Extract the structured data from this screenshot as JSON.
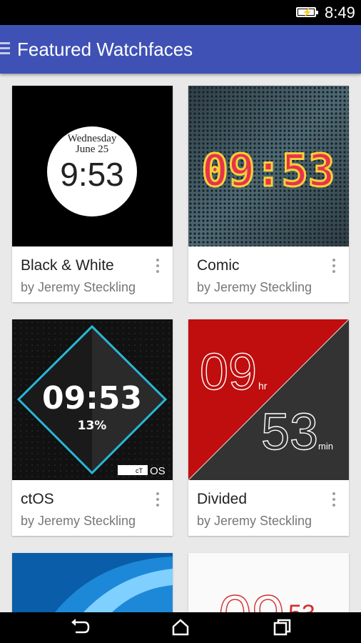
{
  "status": {
    "time": "8:49",
    "battery_icon": "battery-charging-icon"
  },
  "appbar": {
    "title": "Featured Watchfaces",
    "menu_icon": "menu-icon",
    "color": "#3f51b5"
  },
  "cards": [
    {
      "name": "Black & White",
      "author": "by Jeremy Steckling",
      "face": {
        "day": "Wednesday",
        "date": "June 25",
        "time": "9:53"
      }
    },
    {
      "name": "Comic",
      "author": "by Jeremy Steckling",
      "face": {
        "time": "09:53"
      }
    },
    {
      "name": "ctOS",
      "author": "by Jeremy Steckling",
      "face": {
        "time": "09:53",
        "battery": "13%",
        "logo_prefix": "cT",
        "logo_suffix": "OS"
      }
    },
    {
      "name": "Divided",
      "author": "by Jeremy Steckling",
      "face": {
        "hour": "09",
        "hour_unit": "hr",
        "minute": "53",
        "minute_unit": "min"
      }
    },
    {
      "name": "",
      "author": "",
      "face": {}
    },
    {
      "name": "",
      "author": "",
      "face": {
        "time_partial": "09",
        "minute_partial": "53"
      }
    }
  ],
  "navbar": {
    "back_icon": "back-icon",
    "home_icon": "home-icon",
    "recents_icon": "recents-icon"
  }
}
